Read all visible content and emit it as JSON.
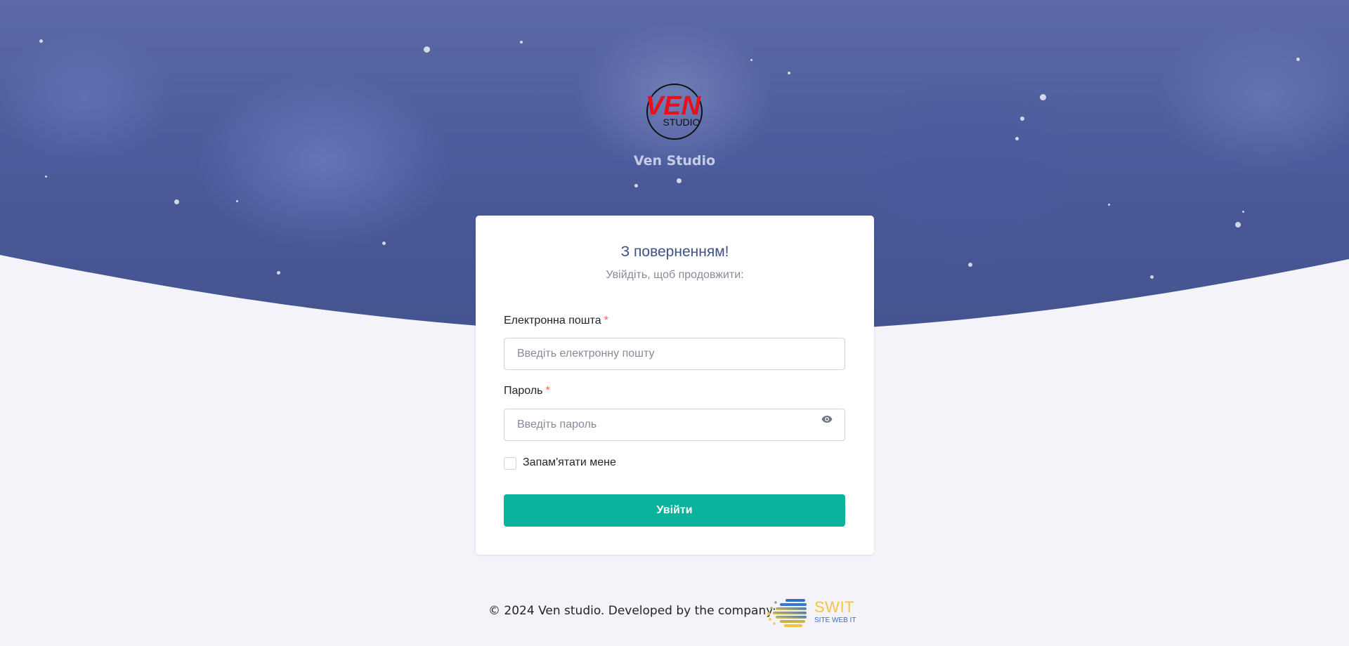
{
  "brand": {
    "logo_text_top": "VEN",
    "logo_text_bottom": "STUDIO",
    "name": "Ven Studio",
    "logo_color": "#e8101a"
  },
  "login": {
    "title": "З поверненням!",
    "subtitle": "Увійдіть, щоб продовжити:",
    "email": {
      "label": "Електронна пошта",
      "required_mark": "*",
      "placeholder": "Введіть електронну пошту",
      "value": ""
    },
    "password": {
      "label": "Пароль",
      "required_mark": "*",
      "placeholder": "Введіть пароль",
      "value": "",
      "toggle_icon": "eye-icon"
    },
    "remember": {
      "label": "Запам'ятати мене",
      "checked": false
    },
    "submit_label": "Увійти"
  },
  "footer": {
    "text": "© 2024 Ven studio. Developed by the company:",
    "company_name": "SWIT",
    "company_tagline": "SITE WEB IT"
  },
  "colors": {
    "primary": "#405189",
    "success": "#0ab39c",
    "danger": "#f06548",
    "muted": "#878a99",
    "page_bg": "#f3f3f9"
  }
}
